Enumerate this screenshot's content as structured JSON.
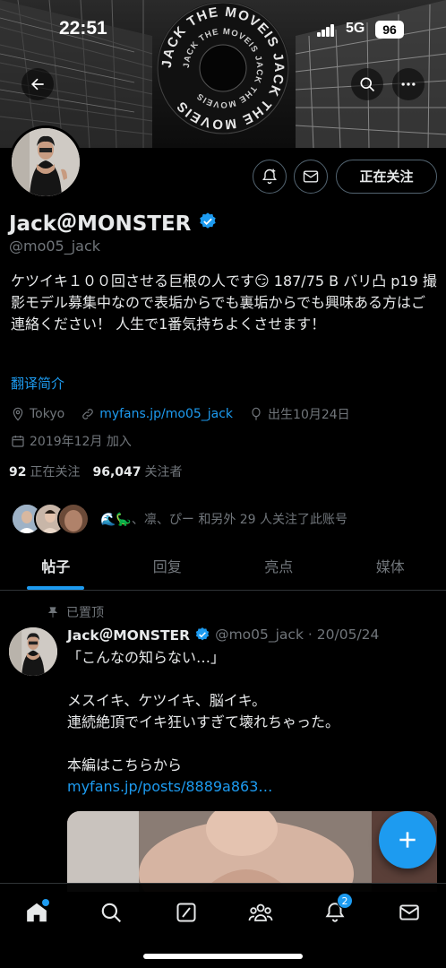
{
  "status_bar": {
    "time": "22:51",
    "network": "5G",
    "battery": "96"
  },
  "banner": {
    "ring_text": "JACK THE MOVEIS JACK THE MOVEIS ",
    "inner_text": "JACK THE MOVEIS JACK THE MOVEIS "
  },
  "profile": {
    "display_name": "Jack＠MONSTER",
    "handle": "@mo05_jack",
    "follow_state": "正在关注",
    "bio": "ケツイキ１００回させる巨根の人です😏 187/75 B バリ凸 p19 撮影モデル募集中なので表垢からでも裏垢からでも興味ある方はご連絡ください！ 人生で1番気持ちよくさせます！",
    "translate_label": "翻译简介",
    "location": "Tokyo",
    "website": "myfans.jp/mo05_jack",
    "birthday": "出生10月24日",
    "joined": "2019年12月 加入",
    "following_count": "92",
    "following_label": "正在关注",
    "followers_count": "96,047",
    "followers_label": "关注者",
    "followed_by": "🌊🦕、凛、ぴー 和另外 29 人关注了此账号"
  },
  "tabs": [
    {
      "label": "帖子",
      "active": true
    },
    {
      "label": "回复",
      "active": false
    },
    {
      "label": "亮点",
      "active": false
    },
    {
      "label": "媒体",
      "active": false
    }
  ],
  "post": {
    "pinned_label": "已置顶",
    "author_name": "Jack＠MONSTER",
    "author_handle": "@mo05_jack",
    "date": "· 20/05/24",
    "lines": [
      "「こんなの知らない…」",
      "",
      "メスイキ、ケツイキ、脳イキ。",
      "連続絶頂でイキ狂いすぎて壊れちゃった。",
      "",
      "本編はこちらから"
    ],
    "link": "myfans.jp/posts/8889a863…"
  },
  "bottom_nav": {
    "notification_badge": "2",
    "items": [
      "home-icon",
      "search-icon",
      "grok-icon",
      "communities-icon",
      "bell-icon",
      "mail-icon"
    ]
  },
  "colors": {
    "accent": "#1d9bf0",
    "muted": "#71767b",
    "text": "#e7e9ea",
    "background": "#000000",
    "border": "#2f3336"
  }
}
